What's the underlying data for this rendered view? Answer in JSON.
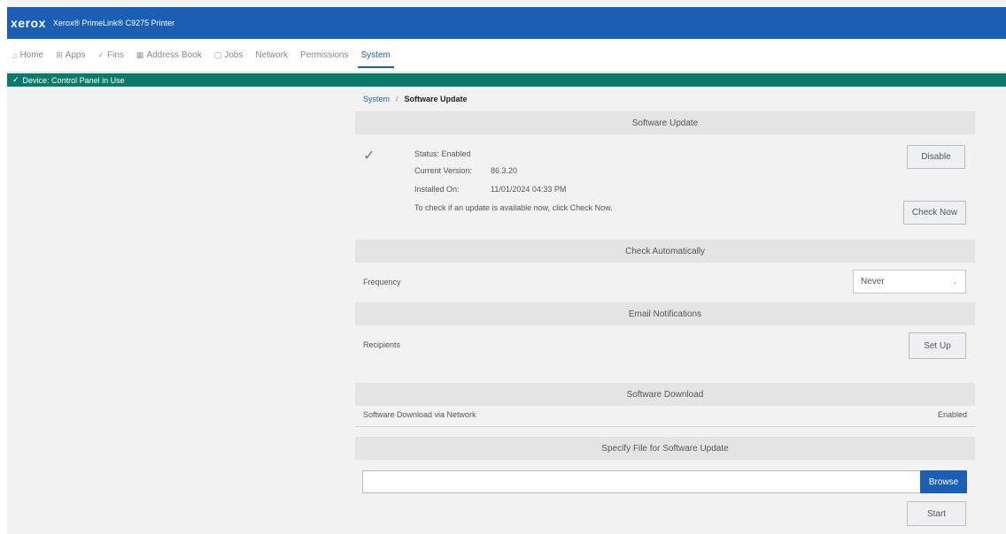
{
  "header": {
    "logo": "xerox",
    "device_name": "Xerox® PrimeLink® C9275 Printer"
  },
  "nav": {
    "items": [
      {
        "label": "Home",
        "icon": "⌂",
        "icon_name": "home-icon"
      },
      {
        "label": "Apps",
        "icon": "⊞",
        "icon_name": "apps-icon"
      },
      {
        "label": "Fins",
        "icon": "✓",
        "icon_name": "check-icon"
      },
      {
        "label": "Address Book",
        "icon": "▦",
        "icon_name": "address-book-icon"
      },
      {
        "label": "Jobs",
        "icon": "▢",
        "icon_name": "jobs-icon"
      },
      {
        "label": "Network",
        "icon": "",
        "icon_name": ""
      },
      {
        "label": "Permissions",
        "icon": "",
        "icon_name": ""
      },
      {
        "label": "System",
        "icon": "",
        "icon_name": ""
      }
    ],
    "active": "System"
  },
  "status_bar": {
    "text": "Device: Control Panel in Use"
  },
  "breadcrumb": {
    "parent": "System",
    "separator": "/",
    "current": "Software Update"
  },
  "software_update": {
    "title": "Software Update",
    "status": "Status: Enabled",
    "current_version_label": "Current Version:",
    "current_version": "86.3.20",
    "installed_on_label": "Installed On:",
    "installed_on": "11/01/2024 04:33 PM",
    "check_hint": "To check if an update is available now, click Check Now.",
    "disable_label": "Disable",
    "check_now_label": "Check Now"
  },
  "check_automatically": {
    "title": "Check Automatically",
    "frequency_label": "Frequency",
    "frequency_value": "Never"
  },
  "email_notifications": {
    "title": "Email Notifications",
    "recipients_label": "Recipients",
    "setup_label": "Set Up"
  },
  "software_download": {
    "title": "Software Download",
    "row_label": "Software Download via Network",
    "row_value": "Enabled"
  },
  "specify_file": {
    "title": "Specify File for Software Update",
    "file_value": "",
    "browse_label": "Browse",
    "start_label": "Start"
  },
  "colors": {
    "header_blue": "#1a5fb4",
    "status_green": "#0a7a6a"
  }
}
